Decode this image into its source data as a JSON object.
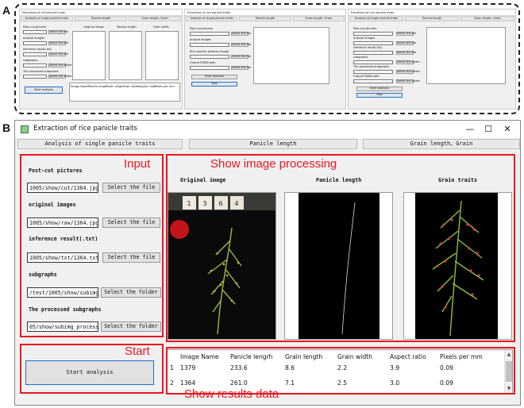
{
  "figure": {
    "panel_a_letter": "A",
    "panel_b_letter": "B"
  },
  "panel_a": {
    "windows": [
      {
        "title": "Extraction of rice panicle traits",
        "tabs": [
          "Analysis of single panicle traits",
          "Panicle length",
          "Grain length, Grain"
        ],
        "fields": [
          "Post-cut pictures",
          "original images",
          "inference result(.txt)",
          "subgraphs",
          "The processed subgraphs"
        ],
        "start": "Start analysis",
        "headers": [
          "Original image",
          "Panicle length",
          "Grain traits"
        ],
        "cols": [
          "Image Name",
          "Panicle length",
          "Grain length",
          "Grain width",
          "Aspect ratio",
          "Pixels per mm"
        ]
      },
      {
        "title": "Extraction of rice panicle traits",
        "tabs": [
          "Analysis of single panicle traits",
          "Panicle length",
          "Grain length, Grain"
        ],
        "fields": [
          "Post-cut pictures",
          "original images",
          "Rice panicle skeleton image",
          "Output RGBD path"
        ],
        "start": "Start analysis",
        "second": "Skip"
      },
      {
        "title": "Extraction of rice panicle traits",
        "tabs": [
          "Analysis of single panicle traits",
          "Panicle length",
          "Grain length, Grain"
        ],
        "fields": [
          "Post-cut pictures",
          "original images",
          "inference result(.txt)",
          "subgraphs",
          "The processed subgraphs",
          "Output RGBD path"
        ],
        "start": "Start analysis",
        "second": "Skip"
      }
    ],
    "btn_file": "Select the file",
    "btn_folder": "Select the folder"
  },
  "app": {
    "title": "Extraction of rice panicle traits",
    "controls": {
      "minimize": "—",
      "maximize": "☐",
      "close": "✕"
    },
    "tabs": [
      "Analysis of single panicle traits",
      "Panicle length",
      "Grain length、Grain"
    ],
    "fields": [
      {
        "label": "Post-cut pictures",
        "value": "1005/show/cut/1364.jpg",
        "button": "Select the file"
      },
      {
        "label": "original images",
        "value": "1005/show/raw/1364.jpg",
        "button": "Select the file"
      },
      {
        "label": "inference result(.txt)",
        "value": "1005/show/txt/1364.txt",
        "button": "Select the file"
      },
      {
        "label": "subgraphs",
        "value": "/test/1005/show/subimg",
        "button": "Select the folder"
      },
      {
        "label": "The processed subgraphs",
        "value": "05/show/subimg_process",
        "button": "Select the folder"
      }
    ],
    "image_titles": [
      "Original image",
      "Panicle length",
      "Grain traits"
    ],
    "tags": [
      "1",
      "3",
      "6",
      "4"
    ],
    "start_button": "Start analysis",
    "results": {
      "columns": [
        "Image Name",
        "Panicle lengrh",
        "Grain length",
        "Grain width",
        "Aspect ratio",
        "Pixels per mm"
      ],
      "rows": [
        {
          "index": "1",
          "cells": [
            "1379",
            "233.6",
            "8.6",
            "2.2",
            "3.9",
            "0.09"
          ]
        },
        {
          "index": "2",
          "cells": [
            "1364",
            "261.0",
            "7.1",
            "2.5",
            "3.0",
            "0.09"
          ]
        }
      ]
    }
  },
  "annotations": {
    "input": "Input",
    "show_processing": "Show image processing",
    "start": "Start",
    "show_results": "Show results data",
    "color": "#e8171e"
  }
}
